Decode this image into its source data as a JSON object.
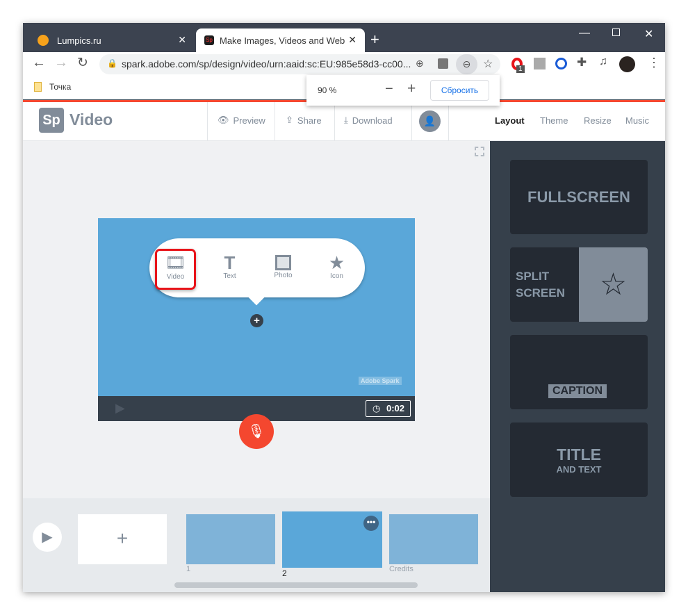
{
  "browser": {
    "tabs": [
      {
        "label": "Lumpics.ru",
        "active": false
      },
      {
        "label": "Make Images, Videos and Web St",
        "active": true
      }
    ],
    "url": "spark.adobe.com/sp/design/video/urn:aaid:sc:EU:985e58d3-cc00...",
    "bookmarks": [
      {
        "label": "Точка"
      }
    ],
    "extension_badge": "1",
    "zoom_popup": {
      "value": "90 %",
      "minus": "−",
      "plus": "+",
      "reset": "Сбросить"
    }
  },
  "app": {
    "logo": "Sp",
    "product": "Video",
    "header": {
      "preview": "Preview",
      "share": "Share",
      "download": "Download"
    },
    "right_tabs": [
      {
        "label": "Layout",
        "active": true
      },
      {
        "label": "Theme"
      },
      {
        "label": "Resize"
      },
      {
        "label": "Music"
      }
    ],
    "add_menu": [
      {
        "label": "Video",
        "icon": "film-icon",
        "highlighted": true
      },
      {
        "label": "Text",
        "icon": "text-icon"
      },
      {
        "label": "Photo",
        "icon": "image-icon"
      },
      {
        "label": "Icon",
        "icon": "star-icon"
      }
    ],
    "watermark": "Adobe Spark",
    "duration": "0:02",
    "layouts": {
      "fullscreen": "FULLSCREEN",
      "split1": "SPLIT",
      "split2": "SCREEN",
      "caption": "CAPTION",
      "title": "TITLE",
      "title_sub": "AND TEXT"
    },
    "slides": [
      {
        "label": "1"
      },
      {
        "label": "2",
        "selected": true
      },
      {
        "label": "Credits"
      }
    ],
    "colors": {
      "accent": "#f4472f",
      "slide": "#5aa7d9",
      "panel": "#36404b",
      "highlight": "#e8141a"
    }
  }
}
